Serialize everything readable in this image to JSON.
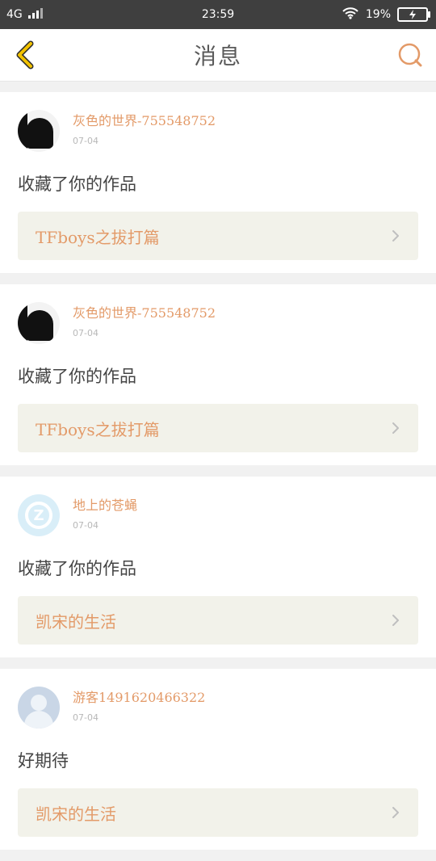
{
  "status_bar": {
    "network": "4G",
    "time": "23:59",
    "battery_percent": "19%"
  },
  "header": {
    "title": "消息"
  },
  "messages": [
    {
      "username": "灰色的世界-755548752",
      "date": "07-04",
      "text": "收藏了你的作品",
      "work_title": "TFboys之拔打篇",
      "avatar": "dark-silhouette"
    },
    {
      "username": "灰色的世界-755548752",
      "date": "07-04",
      "text": "收藏了你的作品",
      "work_title": "TFboys之拔打篇",
      "avatar": "dark-silhouette"
    },
    {
      "username": "地上的苍蝇",
      "date": "07-04",
      "text": "收藏了你的作品",
      "work_title": "凯宋的生活",
      "avatar": "qq-z"
    },
    {
      "username": "游客1491620466322",
      "date": "07-04",
      "text": "好期待",
      "work_title": "凯宋的生活",
      "avatar": "guest"
    }
  ],
  "icons": {
    "back": "chevron-left-icon",
    "search": "search-icon",
    "wifi": "wifi-icon",
    "battery": "battery-icon",
    "signal": "signal-icon",
    "row": "chevron-right-icon"
  },
  "colors": {
    "accent": "#e39a68",
    "back_icon": "#f2c200",
    "status_bar": "#3f3f3f"
  }
}
